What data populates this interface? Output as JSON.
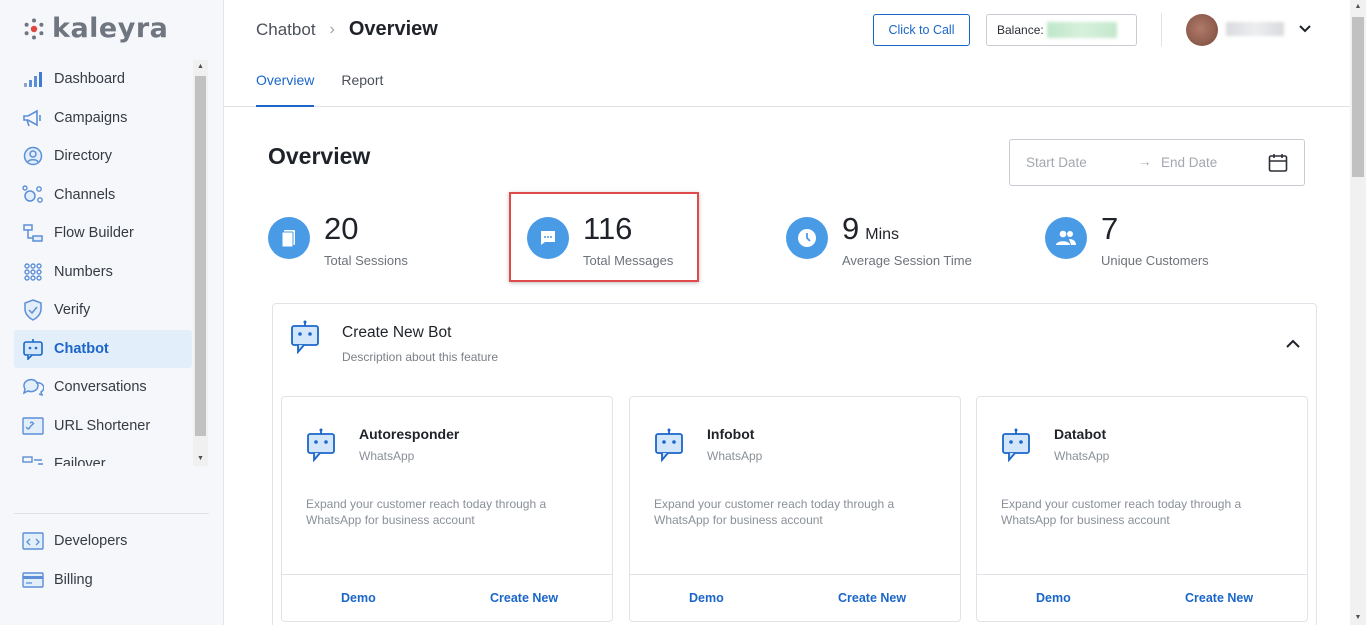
{
  "brand": {
    "name": "kaleyra",
    "accent": "#1a66c9",
    "stat_color": "#4a9be6",
    "highlight": "#e04a4a"
  },
  "sidebar": {
    "items": [
      {
        "label": "Dashboard",
        "icon": "bar-chart-icon"
      },
      {
        "label": "Campaigns",
        "icon": "megaphone-icon"
      },
      {
        "label": "Directory",
        "icon": "user-circle-icon"
      },
      {
        "label": "Channels",
        "icon": "channels-icon"
      },
      {
        "label": "Flow Builder",
        "icon": "flow-icon"
      },
      {
        "label": "Numbers",
        "icon": "dots-grid-icon"
      },
      {
        "label": "Verify",
        "icon": "shield-check-icon"
      },
      {
        "label": "Chatbot",
        "icon": "bot-icon",
        "active": true
      },
      {
        "label": "Conversations",
        "icon": "chat-bubbles-icon"
      },
      {
        "label": "URL Shortener",
        "icon": "link-icon"
      },
      {
        "label": "Failover",
        "icon": "failover-icon"
      }
    ],
    "bottom": [
      {
        "label": "Developers",
        "icon": "code-icon"
      },
      {
        "label": "Billing",
        "icon": "card-icon"
      }
    ]
  },
  "header": {
    "breadcrumb_parent": "Chatbot",
    "breadcrumb_current": "Overview",
    "call_button": "Click to Call",
    "balance_label": "Balance:",
    "tabs": [
      "Overview",
      "Report"
    ]
  },
  "main": {
    "title": "Overview",
    "date_start_placeholder": "Start Date",
    "date_end_placeholder": "End Date",
    "date_arrow": "→",
    "stats": [
      {
        "value": "20",
        "unit": "",
        "label": "Total Sessions",
        "icon": "document-icon"
      },
      {
        "value": "116",
        "unit": "",
        "label": "Total Messages",
        "icon": "message-icon"
      },
      {
        "value": "9",
        "unit": "Mins",
        "label": "Average Session Time",
        "icon": "clock-icon"
      },
      {
        "value": "7",
        "unit": "",
        "label": "Unique Customers",
        "icon": "users-icon"
      }
    ],
    "panel": {
      "title": "Create New Bot",
      "desc": "Description about this feature"
    },
    "cards": [
      {
        "title": "Autoresponder",
        "sub": "WhatsApp",
        "desc": "Expand your customer reach today through a WhatsApp for business account",
        "demo": "Demo",
        "create": "Create New"
      },
      {
        "title": "Infobot",
        "sub": "WhatsApp",
        "desc": "Expand your customer reach today through a WhatsApp for business account",
        "demo": "Demo",
        "create": "Create New"
      },
      {
        "title": "Databot",
        "sub": "WhatsApp",
        "desc": "Expand your customer reach today through a WhatsApp for business account",
        "demo": "Demo",
        "create": "Create New"
      }
    ]
  }
}
